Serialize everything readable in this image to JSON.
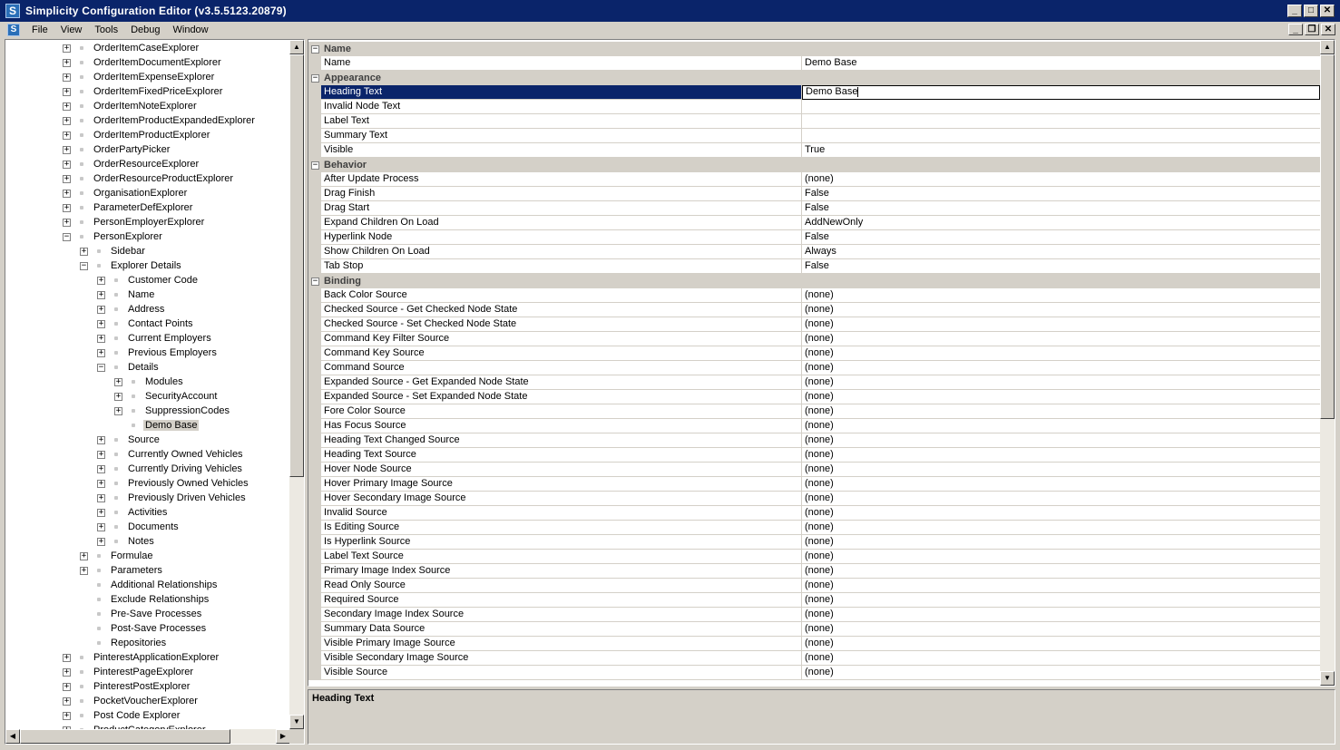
{
  "window": {
    "title": "Simplicity Configuration Editor (v3.5.5123.20879)",
    "app_icon": "S"
  },
  "menu": {
    "items": [
      "File",
      "View",
      "Tools",
      "Debug",
      "Window"
    ]
  },
  "tree": {
    "nodes": [
      {
        "label": "OrderItemCaseExplorer",
        "level": 0,
        "exp": "+"
      },
      {
        "label": "OrderItemDocumentExplorer",
        "level": 0,
        "exp": "+"
      },
      {
        "label": "OrderItemExpenseExplorer",
        "level": 0,
        "exp": "+"
      },
      {
        "label": "OrderItemFixedPriceExplorer",
        "level": 0,
        "exp": "+"
      },
      {
        "label": "OrderItemNoteExplorer",
        "level": 0,
        "exp": "+"
      },
      {
        "label": "OrderItemProductExpandedExplorer",
        "level": 0,
        "exp": "+"
      },
      {
        "label": "OrderItemProductExplorer",
        "level": 0,
        "exp": "+"
      },
      {
        "label": "OrderPartyPicker",
        "level": 0,
        "exp": "+"
      },
      {
        "label": "OrderResourceExplorer",
        "level": 0,
        "exp": "+"
      },
      {
        "label": "OrderResourceProductExplorer",
        "level": 0,
        "exp": "+"
      },
      {
        "label": "OrganisationExplorer",
        "level": 0,
        "exp": "+"
      },
      {
        "label": "ParameterDefExplorer",
        "level": 0,
        "exp": "+"
      },
      {
        "label": "PersonEmployerExplorer",
        "level": 0,
        "exp": "+"
      },
      {
        "label": "PersonExplorer",
        "level": 0,
        "exp": "−"
      },
      {
        "label": "Sidebar",
        "level": 1,
        "exp": "+"
      },
      {
        "label": "Explorer Details",
        "level": 1,
        "exp": "−"
      },
      {
        "label": "Customer Code",
        "level": 2,
        "exp": "+"
      },
      {
        "label": "Name",
        "level": 2,
        "exp": "+"
      },
      {
        "label": "Address",
        "level": 2,
        "exp": "+"
      },
      {
        "label": "Contact Points",
        "level": 2,
        "exp": "+"
      },
      {
        "label": "Current Employers",
        "level": 2,
        "exp": "+"
      },
      {
        "label": "Previous Employers",
        "level": 2,
        "exp": "+"
      },
      {
        "label": "Details",
        "level": 2,
        "exp": "−"
      },
      {
        "label": "Modules",
        "level": 3,
        "exp": "+"
      },
      {
        "label": "SecurityAccount",
        "level": 3,
        "exp": "+"
      },
      {
        "label": "SuppressionCodes",
        "level": 3,
        "exp": "+"
      },
      {
        "label": "Demo Base",
        "level": 3,
        "exp": "",
        "selected": true
      },
      {
        "label": "Source",
        "level": 2,
        "exp": "+"
      },
      {
        "label": "Currently Owned Vehicles",
        "level": 2,
        "exp": "+"
      },
      {
        "label": "Currently Driving Vehicles",
        "level": 2,
        "exp": "+"
      },
      {
        "label": "Previously Owned Vehicles",
        "level": 2,
        "exp": "+"
      },
      {
        "label": "Previously Driven Vehicles",
        "level": 2,
        "exp": "+"
      },
      {
        "label": "Activities",
        "level": 2,
        "exp": "+"
      },
      {
        "label": "Documents",
        "level": 2,
        "exp": "+"
      },
      {
        "label": "Notes",
        "level": 2,
        "exp": "+"
      },
      {
        "label": "Formulae",
        "level": 1,
        "exp": "+"
      },
      {
        "label": "Parameters",
        "level": 1,
        "exp": "+"
      },
      {
        "label": "Additional Relationships",
        "level": 1,
        "exp": ""
      },
      {
        "label": "Exclude Relationships",
        "level": 1,
        "exp": ""
      },
      {
        "label": "Pre-Save Processes",
        "level": 1,
        "exp": ""
      },
      {
        "label": "Post-Save Processes",
        "level": 1,
        "exp": ""
      },
      {
        "label": "Repositories",
        "level": 1,
        "exp": ""
      },
      {
        "label": "PinterestApplicationExplorer",
        "level": 0,
        "exp": "+"
      },
      {
        "label": "PinterestPageExplorer",
        "level": 0,
        "exp": "+"
      },
      {
        "label": "PinterestPostExplorer",
        "level": 0,
        "exp": "+"
      },
      {
        "label": "PocketVoucherExplorer",
        "level": 0,
        "exp": "+"
      },
      {
        "label": "Post Code Explorer",
        "level": 0,
        "exp": "+"
      },
      {
        "label": "ProductCategoryExplorer",
        "level": 0,
        "exp": "+"
      }
    ]
  },
  "properties": {
    "rows": [
      {
        "type": "cat",
        "label": "Name"
      },
      {
        "type": "prop",
        "name": "Name",
        "value": "Demo Base"
      },
      {
        "type": "cat",
        "label": "Appearance"
      },
      {
        "type": "prop",
        "name": "Heading Text",
        "value": "Demo Base",
        "selected": true
      },
      {
        "type": "prop",
        "name": "Invalid Node Text",
        "value": ""
      },
      {
        "type": "prop",
        "name": "Label Text",
        "value": ""
      },
      {
        "type": "prop",
        "name": "Summary Text",
        "value": ""
      },
      {
        "type": "prop",
        "name": "Visible",
        "value": "True"
      },
      {
        "type": "cat",
        "label": "Behavior"
      },
      {
        "type": "prop",
        "name": "After Update Process",
        "value": "(none)"
      },
      {
        "type": "prop",
        "name": "Drag Finish",
        "value": "False"
      },
      {
        "type": "prop",
        "name": "Drag Start",
        "value": "False"
      },
      {
        "type": "prop",
        "name": "Expand Children On Load",
        "value": "AddNewOnly"
      },
      {
        "type": "prop",
        "name": "Hyperlink Node",
        "value": "False"
      },
      {
        "type": "prop",
        "name": "Show Children On Load",
        "value": "Always"
      },
      {
        "type": "prop",
        "name": "Tab Stop",
        "value": "False"
      },
      {
        "type": "cat",
        "label": "Binding"
      },
      {
        "type": "prop",
        "name": "Back Color Source",
        "value": "(none)"
      },
      {
        "type": "prop",
        "name": "Checked Source - Get Checked Node State",
        "value": "(none)"
      },
      {
        "type": "prop",
        "name": "Checked Source - Set Checked Node State",
        "value": "(none)"
      },
      {
        "type": "prop",
        "name": "Command Key Filter Source",
        "value": "(none)"
      },
      {
        "type": "prop",
        "name": "Command Key Source",
        "value": "(none)"
      },
      {
        "type": "prop",
        "name": "Command Source",
        "value": "(none)"
      },
      {
        "type": "prop",
        "name": "Expanded Source - Get Expanded Node State",
        "value": "(none)"
      },
      {
        "type": "prop",
        "name": "Expanded Source - Set Expanded Node State",
        "value": "(none)"
      },
      {
        "type": "prop",
        "name": "Fore Color Source",
        "value": "(none)"
      },
      {
        "type": "prop",
        "name": "Has Focus Source",
        "value": "(none)"
      },
      {
        "type": "prop",
        "name": "Heading Text Changed Source",
        "value": "(none)"
      },
      {
        "type": "prop",
        "name": "Heading Text Source",
        "value": "(none)"
      },
      {
        "type": "prop",
        "name": "Hover Node Source",
        "value": "(none)"
      },
      {
        "type": "prop",
        "name": "Hover Primary Image Source",
        "value": "(none)"
      },
      {
        "type": "prop",
        "name": "Hover Secondary Image Source",
        "value": "(none)"
      },
      {
        "type": "prop",
        "name": "Invalid Source",
        "value": "(none)"
      },
      {
        "type": "prop",
        "name": "Is Editing Source",
        "value": "(none)"
      },
      {
        "type": "prop",
        "name": "Is Hyperlink Source",
        "value": "(none)"
      },
      {
        "type": "prop",
        "name": "Label Text Source",
        "value": "(none)"
      },
      {
        "type": "prop",
        "name": "Primary Image Index Source",
        "value": "(none)"
      },
      {
        "type": "prop",
        "name": "Read Only Source",
        "value": "(none)"
      },
      {
        "type": "prop",
        "name": "Required Source",
        "value": "(none)"
      },
      {
        "type": "prop",
        "name": "Secondary Image Index Source",
        "value": "(none)"
      },
      {
        "type": "prop",
        "name": "Summary Data Source",
        "value": "(none)"
      },
      {
        "type": "prop",
        "name": "Visible Primary Image Source",
        "value": "(none)"
      },
      {
        "type": "prop",
        "name": "Visible Secondary Image Source",
        "value": "(none)"
      },
      {
        "type": "prop",
        "name": "Visible Source",
        "value": "(none)"
      }
    ]
  },
  "description": {
    "title": "Heading Text"
  },
  "colors": {
    "title_bar": "#0a246a",
    "selection": "#0a246a",
    "face": "#d4d0c8"
  }
}
